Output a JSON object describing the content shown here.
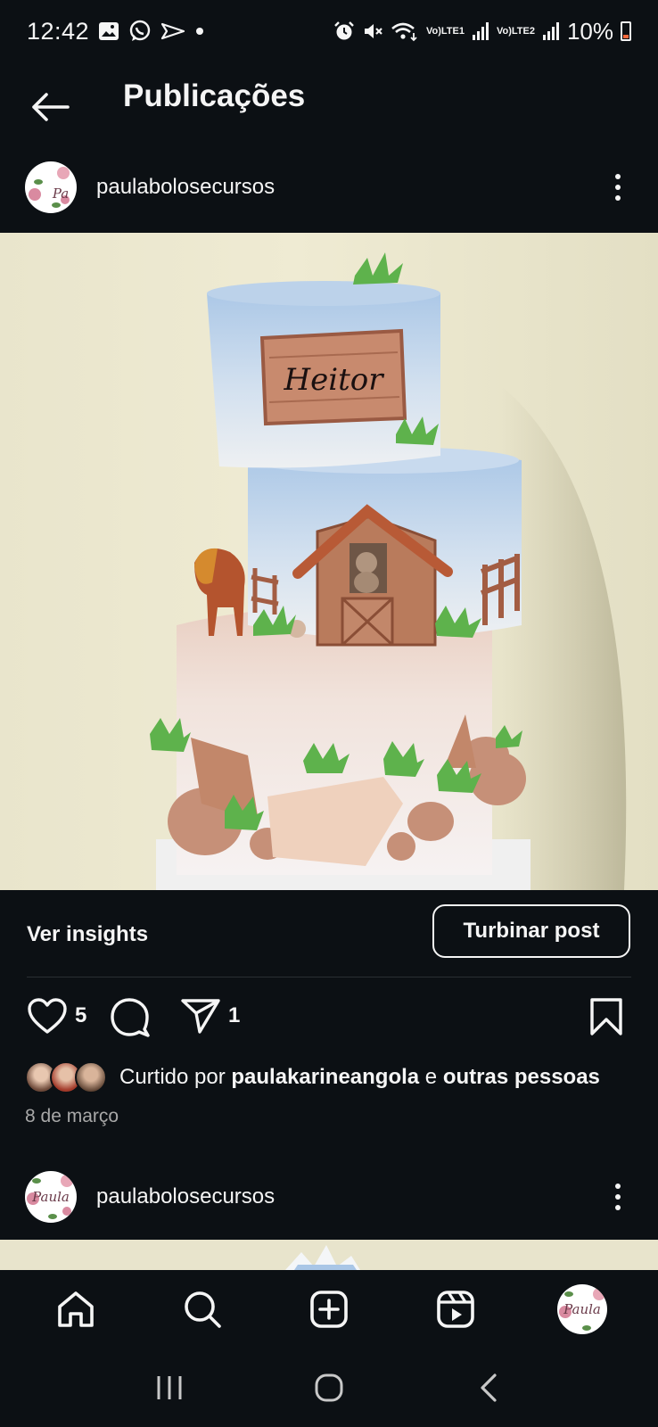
{
  "status_bar": {
    "time": "12:42",
    "lte1": "LTE1",
    "lte2": "LTE2",
    "volte1": "Vo)",
    "volte2": "Vo)",
    "battery": "10%"
  },
  "header": {
    "title": "Publicações"
  },
  "post": {
    "username": "paulabolosecursos",
    "avatar_text": "Pa",
    "photo_text": "Heitor",
    "insights_label": "Ver insights",
    "boost_label": "Turbinar post",
    "like_count": "5",
    "share_count": "1",
    "liked_by_prefix": "Curtido por ",
    "liked_by_user": "paulakarineangola",
    "liked_by_mid": " e ",
    "liked_by_others": "outras pessoas",
    "date": "8 de março"
  },
  "next_post": {
    "username": "paulabolosecursos",
    "avatar_text": "Paula"
  },
  "bottom_nav": {
    "profile_avatar_text": "Paula"
  },
  "icons": {
    "status": [
      "gallery-icon",
      "whatsapp-icon",
      "send-icon",
      "alarm-icon",
      "mute-icon",
      "wifi-icon",
      "signal-icon",
      "battery-icon"
    ],
    "actions": [
      "heart-icon",
      "comment-icon",
      "share-icon",
      "bookmark-icon"
    ],
    "nav": [
      "home-icon",
      "search-icon",
      "create-icon",
      "reels-icon",
      "profile-avatar"
    ],
    "system": [
      "recents-icon",
      "home-circle-icon",
      "back-chevron-icon"
    ]
  },
  "colors": {
    "background": "#0c1014",
    "text": "#f5f5f5",
    "muted": "#a8a8a8",
    "battery_low": "#ff6a3d"
  }
}
